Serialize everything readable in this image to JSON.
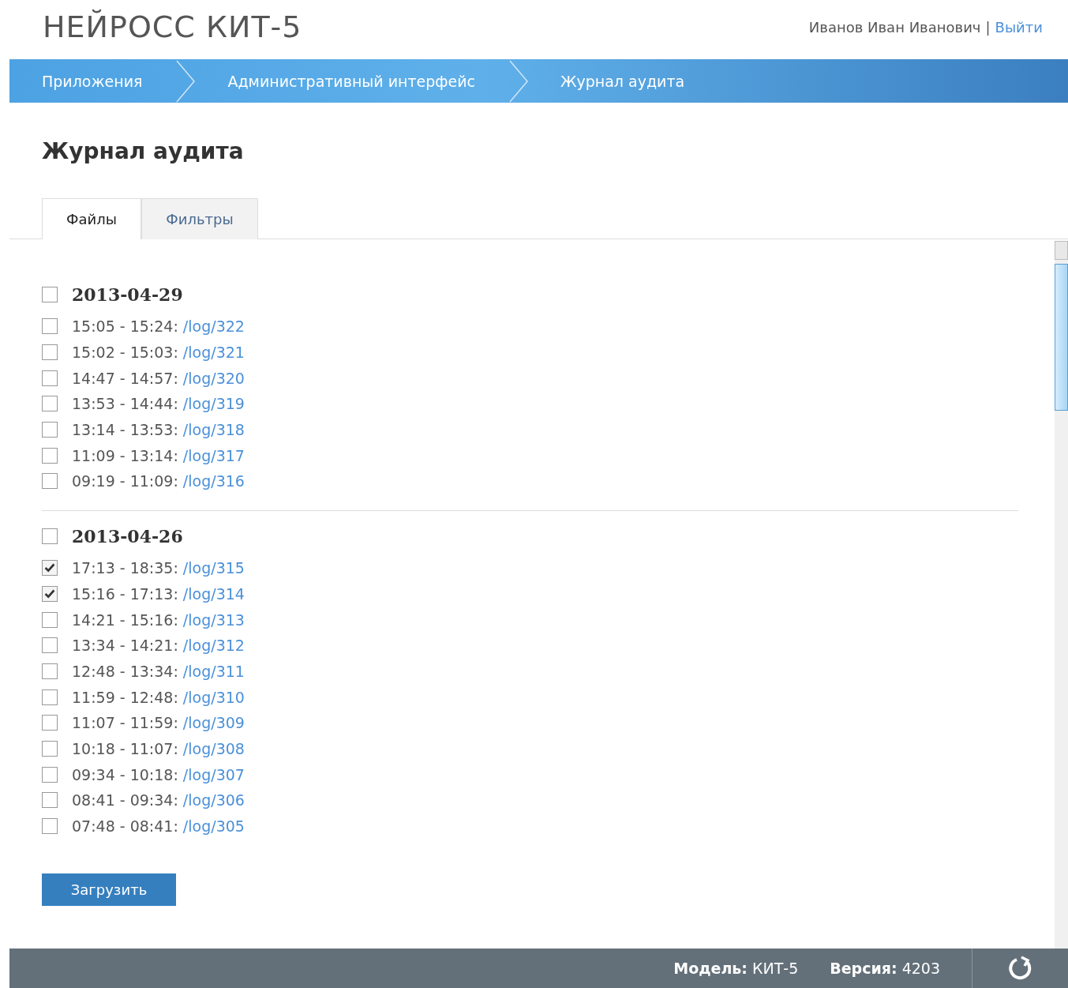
{
  "header": {
    "logo": "НЕЙРОСС КИТ-5",
    "user": "Иванов Иван Иванович",
    "separator": "|",
    "logout": "Выйти"
  },
  "breadcrumbs": [
    {
      "label": "Приложения"
    },
    {
      "label": "Административный интерфейс"
    },
    {
      "label": "Журнал аудита"
    }
  ],
  "page_title": "Журнал аудита",
  "tabs": [
    {
      "label": "Файлы",
      "selected": true
    },
    {
      "label": "Фильтры",
      "selected": false
    }
  ],
  "groups": [
    {
      "date": "2013-04-29",
      "checked": false,
      "files": [
        {
          "time": "15:05 - 15:24:",
          "link": "/log/322",
          "checked": false
        },
        {
          "time": "15:02 - 15:03:",
          "link": "/log/321",
          "checked": false
        },
        {
          "time": "14:47 - 14:57:",
          "link": "/log/320",
          "checked": false
        },
        {
          "time": "13:53 - 14:44:",
          "link": "/log/319",
          "checked": false
        },
        {
          "time": "13:14 - 13:53:",
          "link": "/log/318",
          "checked": false
        },
        {
          "time": "11:09 - 13:14:",
          "link": "/log/317",
          "checked": false
        },
        {
          "time": "09:19 - 11:09:",
          "link": "/log/316",
          "checked": false
        }
      ]
    },
    {
      "date": "2013-04-26",
      "checked": false,
      "files": [
        {
          "time": "17:13 - 18:35:",
          "link": "/log/315",
          "checked": true
        },
        {
          "time": "15:16 - 17:13:",
          "link": "/log/314",
          "checked": true
        },
        {
          "time": "14:21 - 15:16:",
          "link": "/log/313",
          "checked": false
        },
        {
          "time": "13:34 - 14:21:",
          "link": "/log/312",
          "checked": false
        },
        {
          "time": "12:48 - 13:34:",
          "link": "/log/311",
          "checked": false
        },
        {
          "time": "11:59 - 12:48:",
          "link": "/log/310",
          "checked": false
        },
        {
          "time": "11:07 - 11:59:",
          "link": "/log/309",
          "checked": false
        },
        {
          "time": "10:18 - 11:07:",
          "link": "/log/308",
          "checked": false
        },
        {
          "time": "09:34 - 10:18:",
          "link": "/log/307",
          "checked": false
        },
        {
          "time": "08:41 - 09:34:",
          "link": "/log/306",
          "checked": false
        },
        {
          "time": "07:48 - 08:41:",
          "link": "/log/305",
          "checked": false
        }
      ]
    }
  ],
  "load_button": "Загрузить",
  "footer": {
    "model_label": "Модель:",
    "model": "КИТ-5",
    "version_label": "Версия:",
    "version": "4203"
  }
}
